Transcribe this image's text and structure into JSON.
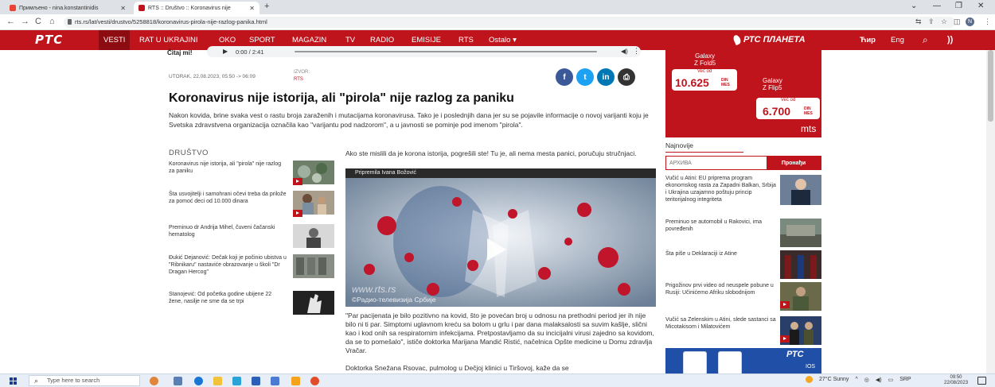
{
  "browser": {
    "tabs": [
      {
        "label": "Примљено - nina.konstantinidis"
      },
      {
        "label": "RTS :: Društvo :: Koronavirus nije"
      }
    ],
    "new_tab": "+",
    "url": "rts.rs/lat/vesti/drustvo/5258818/koronavirus-pirola-nije-razlog-panika.html",
    "win_minimize": "—",
    "win_restore": "❐",
    "win_close": "✕",
    "win_chevron": "⌄",
    "profile_initial": "N"
  },
  "site_nav": {
    "logo": "РТС",
    "items": [
      "VESTI",
      "RAT U UKRAJINI",
      "OKO",
      "SPORT",
      "MAGAZIN",
      "TV",
      "RADIO",
      "EMISIJE",
      "RTS",
      "Ostalo ▾"
    ],
    "planeta": "РТС ПЛАНЕТА",
    "lang_cyr": "Ћир",
    "lang_eng": "Eng"
  },
  "audio": {
    "label": "Čitaj mi!",
    "time": "0:00 / 2:41"
  },
  "article": {
    "date": "UTORAK, 22.08.2023, 05:50 -> 06:09",
    "source_label": "IZVOR:",
    "source": "RTS",
    "title": "Koronavirus nije istorija, ali \"pirola\" nije razlog za paniku",
    "lead": "Nakon kovida, brine svaka vest o rastu broja zaraženih i mutacijama koronavirusa. Tako je i poslednjih dana jer su se pojavile informacije o novoj varijanti koju je Svetska zdravstvena organizacija označila kao \"varijantu pod nadzorom\", a u javnosti se pominje pod imenom \"pirola\".",
    "intro": "Ako ste mislili da je korona istorija, pogrešili ste! Tu je, ali nema mesta panici, poručuju stručnjaci.",
    "video_caption": "Pripremila Ivana Božović",
    "watermark": "www.rts.rs",
    "watermark_copy": "©Радио-телевизија Србије",
    "body1": "\"Par pacijenata je bilo pozitivno na kovid, što je povećan broj u odnosu na prethodni period jer ih nije bilo ni ti par. Simptomi uglavnom kreću sa bolom u grlu i par dana malaksalosti sa suvim kašlje, slični kao i kod onih sa respiratornim infekcijama. Pretpostavljamo da su incicijalni virusi zajedno sa kovidom, da se to pomešalo\", ističe doktorka Marijana Mandić Ristić, načelnica Opšte medicine u Domu zdravlja Vračar.",
    "body2": "Doktorka Snežana Rsovac, pulmolog u Dečjoj klinici u Tiršovoj, kaže da se"
  },
  "left_column": {
    "section": "DRUŠTVO",
    "items": [
      {
        "text": "Koronavirus nije istorija, ali \"pirola\" nije razlog za paniku"
      },
      {
        "text": "Šta usvojitelji i samohrani očevi treba da prilože za pomoć deci od 10.000 dinara"
      },
      {
        "text": "Preminuo dr Andrija Mihel, čuveni čačanski hematolog"
      },
      {
        "text": "Đukić Dejanović: Dečak koji je počinio ubistva u \"Ribnikaru\" nastaviće obrazovanje u školi \"Dr Dragan Hercog\""
      },
      {
        "text": "Stanojević: Od početka godine ubijene 22 žene, nasilje ne sme da se trpi"
      }
    ]
  },
  "ad": {
    "fold": "Galaxy\nZ Fold5",
    "vec_od_1": "Već od",
    "price_1": "10.625",
    "cur_1": "DIN MES",
    "flip": "Galaxy\nZ Flip5",
    "vec_od_2": "Već od",
    "price_2": "6.700",
    "cur_2": "DIN MES",
    "brand": "mts"
  },
  "right_column": {
    "najnovije": "Najnovije",
    "search_placeholder": "АРХИВА",
    "search_button": "Пронађи",
    "items": [
      {
        "text": "Vučić u Atini: EU priprema program ekonomskog rasta za Zapadni Balkan, Srbija i Ukrajina uzajamno poštuju princip teritorijalnog integriteta"
      },
      {
        "text": "Preminuo se automobil u Rakovici, ima povređenih"
      },
      {
        "text": "Šta piše u Deklaraciji iz Atine"
      },
      {
        "text": "Prigožinov prvi video od neuspele pobune u Rusiji: Učinićemo Afriku slobodnijom"
      },
      {
        "text": "Vučić sa Zelenskim u Atini, slede sastanci sa Micotakisom i Milatovićem"
      }
    ],
    "promo_logo": "РТС",
    "promo_ios": "IOS"
  },
  "taskbar": {
    "search_placeholder": "Type here to search",
    "weather": "27°C  Sunny",
    "lang": "SRP",
    "time": "09:50",
    "date": "22/08/2023"
  },
  "colors": {
    "rts_red": "#c0141d",
    "facebook": "#3b5998",
    "twitter": "#1da1f2",
    "linkedin": "#0077b5",
    "print": "#333333"
  }
}
